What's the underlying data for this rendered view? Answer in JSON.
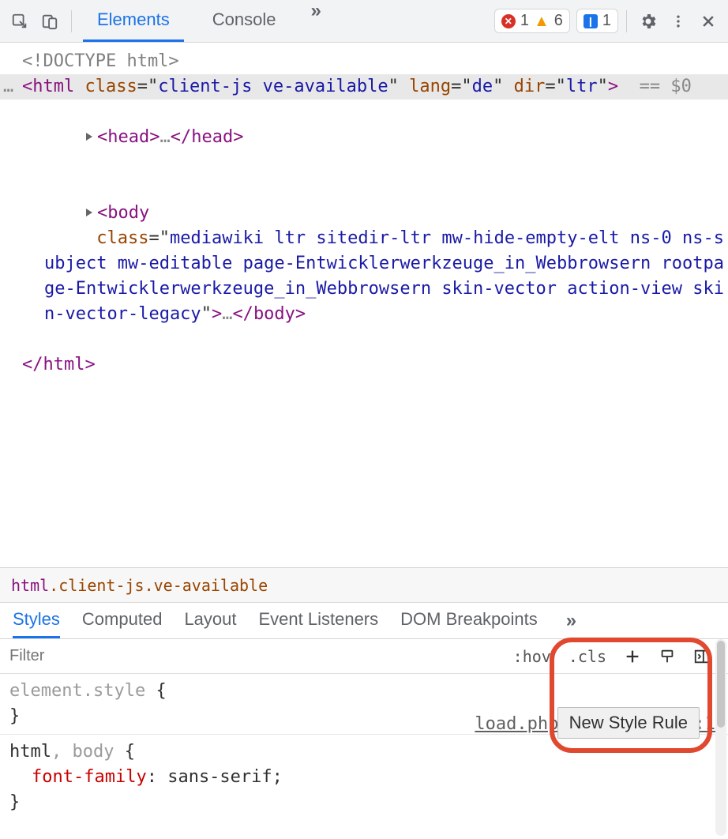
{
  "toolbar": {
    "tabs": {
      "elements": "Elements",
      "console": "Console"
    },
    "errors_count": "1",
    "warnings_count": "6",
    "issues_count": "1"
  },
  "dom": {
    "doctype": "<!DOCTYPE html>",
    "html_open_tag": "html",
    "html_class": "client-js ve-available",
    "html_lang": "de",
    "html_dir": "ltr",
    "selected_marker": "== $0",
    "head_tag": "head",
    "head_ellipsis": "…",
    "body_tag": "body",
    "body_class": "mediawiki ltr sitedir-ltr mw-hide-empty-elt ns-0 ns-subject mw-editable page-Entwicklerwerkzeuge_in_Webbrowsern rootpage-Entwicklerwerkzeuge_in_Webbrowsern skin-vector action-view skin-vector-legacy",
    "body_ellipsis": "…",
    "html_close": "</html>"
  },
  "breadcrumb": {
    "tag": "html",
    "classes": ".client-js.ve-available"
  },
  "styles": {
    "tabs": {
      "styles": "Styles",
      "computed": "Computed",
      "layout": "Layout",
      "eventlisteners": "Event Listeners",
      "dombreak": "DOM Breakpoints"
    },
    "filter_placeholder": "Filter",
    "hov": ":hov",
    "cls": ".cls",
    "tooltip": "New Style Rule",
    "rule1": {
      "selector": "element.style",
      "open": "{",
      "close": "}"
    },
    "rule2": {
      "selector_html": "html",
      "selector_sep": ", ",
      "selector_body": "body",
      "open": "{",
      "prop_name": "font-family",
      "prop_val": "sans-serif;",
      "colon": ": ",
      "close": "}",
      "source": "load.php?la…in=vector:1"
    }
  }
}
